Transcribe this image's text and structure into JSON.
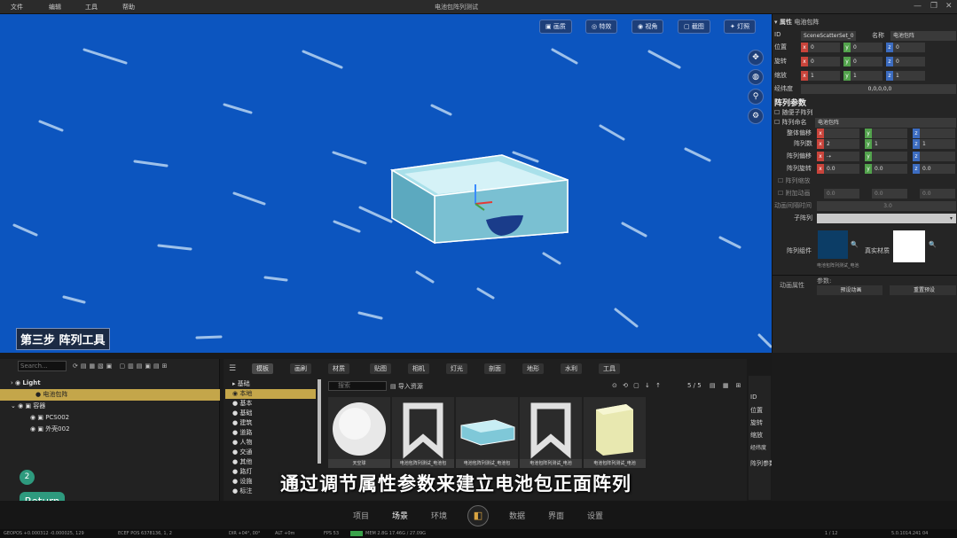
{
  "titlebar": {
    "menus": [
      "文件",
      "编辑",
      "工具",
      "帮助"
    ],
    "title": "电池包阵列测试"
  },
  "viewport": {
    "buttons": [
      "画质",
      "特效",
      "视角",
      "截图",
      "灯照"
    ],
    "side_icons": [
      "move-icon",
      "globe-icon",
      "walk-icon",
      "settings-icon"
    ],
    "step_label": "第三步 阵列工具"
  },
  "props": {
    "header": "属性",
    "header_sub": "电池包阵",
    "id_label": "ID",
    "id_value": "SceneScatterSet_0",
    "name_label": "名称",
    "name_value": "电池包阵",
    "pos_label": "位置",
    "pos": [
      "0",
      "0",
      "0"
    ],
    "rot_label": "旋转",
    "rot": [
      "0",
      "0",
      "0"
    ],
    "scale_label": "缩放",
    "scale": [
      "1",
      "1",
      "1"
    ],
    "lock_label": "经纬度",
    "lock_value": "0,0,0,0,0",
    "array_title": "阵列参数",
    "check1": "随便子阵列",
    "check2": "阵列命名",
    "check2_value": "电池包阵",
    "overall_offset": "整体偏移",
    "array_count": "阵列数",
    "array_count_vals": [
      "2",
      "1",
      "1"
    ],
    "array_offset": "阵列偏移",
    "array_rot": "阵列旋转",
    "array_rot_vals": [
      "0.0",
      "0.0",
      "0.0"
    ],
    "array_scale": "阵列缩放",
    "extra_anim": "附加动画",
    "extra_vals": [
      "0.0",
      "0.0",
      "0.0"
    ],
    "anim_delay": "动画间隔时间",
    "anim_delay_val": "3.0",
    "child_array": "子阵列",
    "array_assets": "阵列组件",
    "asset_name": "电池包阵列测试_电池",
    "material": "真实材质",
    "anim_props": "动画属性",
    "params": "参数:",
    "preset_anim": "预设动画",
    "reset_preset": "重置预设"
  },
  "outliner": {
    "search_placeholder": "Search...",
    "rows": [
      {
        "label": "Light",
        "level": 0,
        "selected": false
      },
      {
        "label": "电池包阵",
        "level": 1,
        "selected": true
      },
      {
        "label": "容器",
        "level": 1,
        "selected": false
      },
      {
        "label": "PCS002",
        "level": 2,
        "selected": false
      },
      {
        "label": "外壳002",
        "level": 2,
        "selected": false
      }
    ]
  },
  "assets": {
    "tabs": [
      "模板",
      "画刷",
      "材质",
      "贴图",
      "相机",
      "灯光",
      "剖面",
      "地形",
      "水利",
      "工具"
    ],
    "search_placeholder": "搜索",
    "import_label": "导入资源",
    "page": "5 / 5",
    "categories": [
      "基础",
      "本地",
      "基本",
      "基础",
      "建筑",
      "道路",
      "人物",
      "交通",
      "其他",
      "路灯",
      "设施",
      "标注"
    ],
    "items": [
      {
        "caption": "天空球",
        "kind": "sphere"
      },
      {
        "caption": "电池包阵列测试_电池包",
        "kind": "bookmark"
      },
      {
        "caption": "电池包阵列测试_电池包",
        "kind": "tray"
      },
      {
        "caption": "电池包阵列测试_电池",
        "kind": "bookmark"
      },
      {
        "caption": "电池包阵列测试_电池",
        "kind": "cell"
      }
    ]
  },
  "bottom_props": {
    "id": "ID",
    "pos": "位置",
    "rot": "旋转",
    "scale": "缩放",
    "lnglat": "经纬度",
    "array": "阵列参数"
  },
  "subtitle": "通过调节属性参数来建立电池包正面阵列",
  "return_badge": "2",
  "return_label": "Return",
  "nav": [
    "项目",
    "场景",
    "环境",
    "数据",
    "界面",
    "设置"
  ],
  "status": {
    "left": "GEOPOS +0.000312 -0.000025, 129",
    "mid": "ECEF POS 6378136, 1, 2",
    "dir": "DIR +04°, 00°",
    "alt": "ALT +0m",
    "fps": "FPS 53",
    "mem": "MEM 2.8G 17.46G / 27.09G",
    "right": "5.0.1014.241 04",
    "frames": "1 / 12"
  },
  "colors": {
    "viewport_bg": "#0c55bf",
    "selected_row": "#c4a64a",
    "accent_green": "#2e9a7e"
  }
}
